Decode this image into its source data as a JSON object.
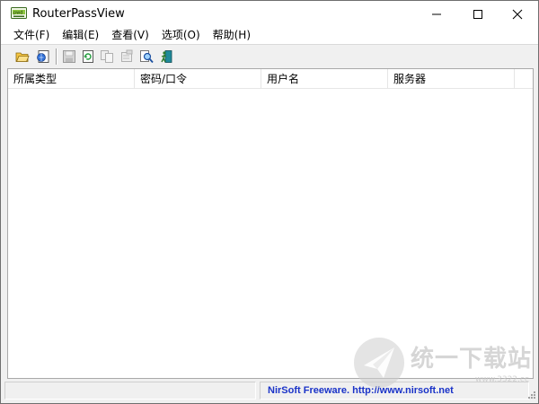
{
  "window": {
    "title": "RouterPassView",
    "icon": "routerpassview-app-icon"
  },
  "titlebar_buttons": [
    "minimize-icon",
    "maximize-icon",
    "close-icon"
  ],
  "menu": [
    {
      "label": "文件(F)"
    },
    {
      "label": "编辑(E)"
    },
    {
      "label": "查看(V)"
    },
    {
      "label": "选项(O)"
    },
    {
      "label": "帮助(H)"
    }
  ],
  "toolbar": [
    {
      "icon": "open-folder-icon",
      "enabled": true
    },
    {
      "icon": "open-html-icon",
      "enabled": true
    },
    {
      "icon": "save-icon",
      "enabled": false
    },
    {
      "icon": "refresh-icon",
      "enabled": true
    },
    {
      "icon": "copy-icon",
      "enabled": false
    },
    {
      "icon": "properties-icon",
      "enabled": false
    },
    {
      "icon": "find-icon",
      "enabled": true
    },
    {
      "icon": "exit-icon",
      "enabled": true
    }
  ],
  "listview": {
    "columns": [
      "所属类型",
      "密码/口令",
      "用户名",
      "服务器"
    ],
    "rows": []
  },
  "statusbar": {
    "left": "",
    "link": "NirSoft Freeware.  http://www.nirsoft.net"
  },
  "watermark": {
    "text": "统一下载站",
    "sub": "www.3322.cc"
  }
}
